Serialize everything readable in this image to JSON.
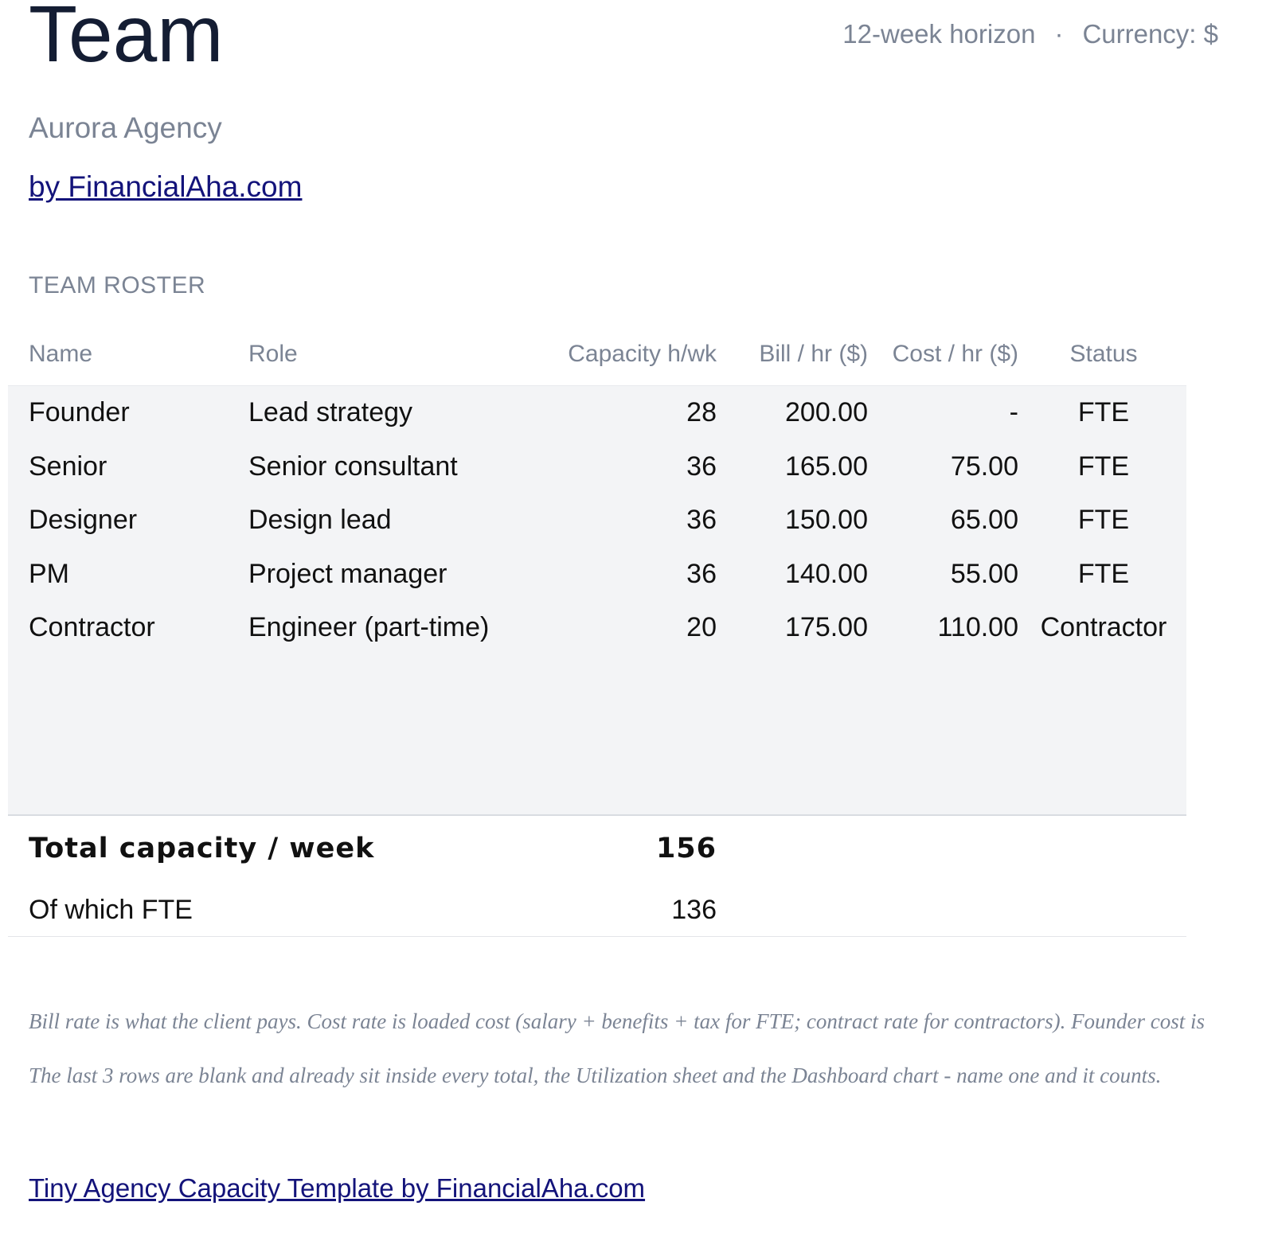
{
  "header": {
    "title": "Team",
    "horizon": "12-week horizon",
    "separator": "·",
    "currency": "Currency: $",
    "company": "Aurora Agency",
    "byline": "by FinancialAha.com"
  },
  "roster": {
    "section_title": "TEAM ROSTER",
    "columns": {
      "name": "Name",
      "role": "Role",
      "capacity": "Capacity h/wk",
      "bill": "Bill / hr ($)",
      "cost": "Cost / hr ($)",
      "status": "Status"
    },
    "rows": [
      {
        "name": "Founder",
        "role": "Lead strategy",
        "capacity": "28",
        "bill": "200.00",
        "cost": "-",
        "status": "FTE"
      },
      {
        "name": "Senior",
        "role": "Senior consultant",
        "capacity": "36",
        "bill": "165.00",
        "cost": "75.00",
        "status": "FTE"
      },
      {
        "name": "Designer",
        "role": "Design lead",
        "capacity": "36",
        "bill": "150.00",
        "cost": "65.00",
        "status": "FTE"
      },
      {
        "name": "PM",
        "role": "Project manager",
        "capacity": "36",
        "bill": "140.00",
        "cost": "55.00",
        "status": "FTE"
      },
      {
        "name": "Contractor",
        "role": "Engineer (part-time)",
        "capacity": "20",
        "bill": "175.00",
        "cost": "110.00",
        "status": "Contractor"
      }
    ],
    "total": {
      "label": "Total capacity / week",
      "value": "156"
    },
    "fte": {
      "label": "Of which FTE",
      "value": "136"
    }
  },
  "notes": [
    "Bill rate is what the client pays. Cost rate is loaded cost (salary + benefits + tax for FTE; contract rate for contractors). Founder cost is",
    "The last 3 rows are blank and already sit inside every total, the Utilization sheet and the Dashboard chart - name one and it counts."
  ],
  "footer": {
    "link": "Tiny Agency Capacity Template by FinancialAha.com"
  }
}
